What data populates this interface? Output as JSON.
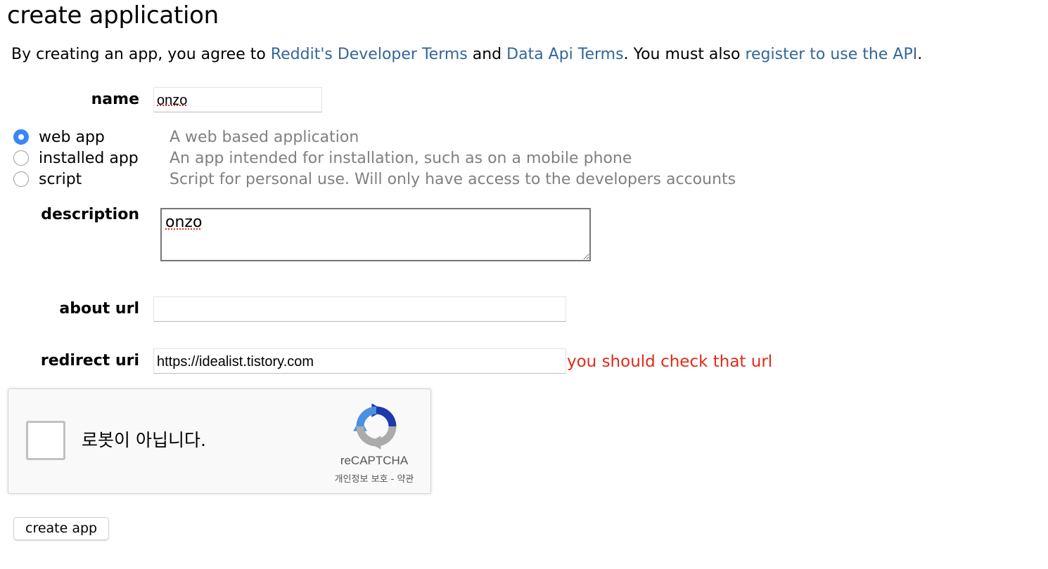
{
  "page": {
    "title": "create application"
  },
  "terms": {
    "prefix": "By creating an app, you agree to ",
    "developer_terms_link": "Reddit's Developer Terms",
    "and": " and ",
    "data_api_terms_link": "Data Api Terms",
    "middle": ". You must also ",
    "register_link": "register to use the API",
    "suffix": "."
  },
  "form": {
    "name": {
      "label": "name",
      "value": "onzo"
    },
    "app_types": [
      {
        "label": "web app",
        "description": "A web based application",
        "selected": true
      },
      {
        "label": "installed app",
        "description": "An app intended for installation, such as on a mobile phone",
        "selected": false
      },
      {
        "label": "script",
        "description": "Script for personal use. Will only have access to the developers accounts",
        "selected": false
      }
    ],
    "description": {
      "label": "description",
      "value": "onzo"
    },
    "about_url": {
      "label": "about url",
      "value": ""
    },
    "redirect_uri": {
      "label": "redirect uri",
      "value": "https://idealist.tistory.com",
      "error": "you should check that url"
    }
  },
  "captcha": {
    "checkbox_label": "로봇이 아닙니다.",
    "brand": "reCAPTCHA",
    "links": "개인정보 보호 - 약관",
    "icon": "recaptcha-logo-icon"
  },
  "submit": {
    "label": "create app"
  },
  "colors": {
    "link": "#336699",
    "error": "#e02a1a",
    "radio_selected": "#3a86f7",
    "muted": "#808080"
  }
}
